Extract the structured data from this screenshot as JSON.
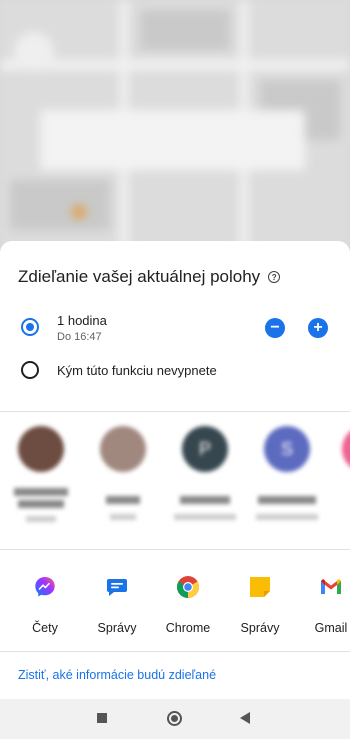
{
  "sheet": {
    "title": "Zdieľanie vašej aktuálnej polohy",
    "options": [
      {
        "label": "1 hodina",
        "sub": "Do 16:47",
        "selected": true
      },
      {
        "label": "Kým túto funkciu nevypnete",
        "selected": false
      }
    ],
    "stepper": {
      "decrease": "−",
      "increase": "+"
    }
  },
  "contacts": [
    {
      "icon": "avatar-photo",
      "color": "#6d4c41"
    },
    {
      "icon": "avatar-photo",
      "color": "#a1887f"
    },
    {
      "initial": "P",
      "color": "#37474f"
    },
    {
      "initial": "S",
      "color": "#5c6bc0"
    },
    {
      "icon": "avatar-partial",
      "color": "#f06292"
    }
  ],
  "apps": [
    {
      "label": "Čety",
      "icon": "messenger-icon"
    },
    {
      "label": "Správy",
      "icon": "messages-bubble-icon"
    },
    {
      "label": "Chrome",
      "icon": "chrome-icon"
    },
    {
      "label": "Správy",
      "icon": "note-icon"
    },
    {
      "label": "Gmail",
      "icon": "gmail-icon"
    }
  ],
  "footer": {
    "link": "Zistiť, aké informácie budú zdieľané"
  },
  "colors": {
    "accent": "#1a73e8"
  }
}
